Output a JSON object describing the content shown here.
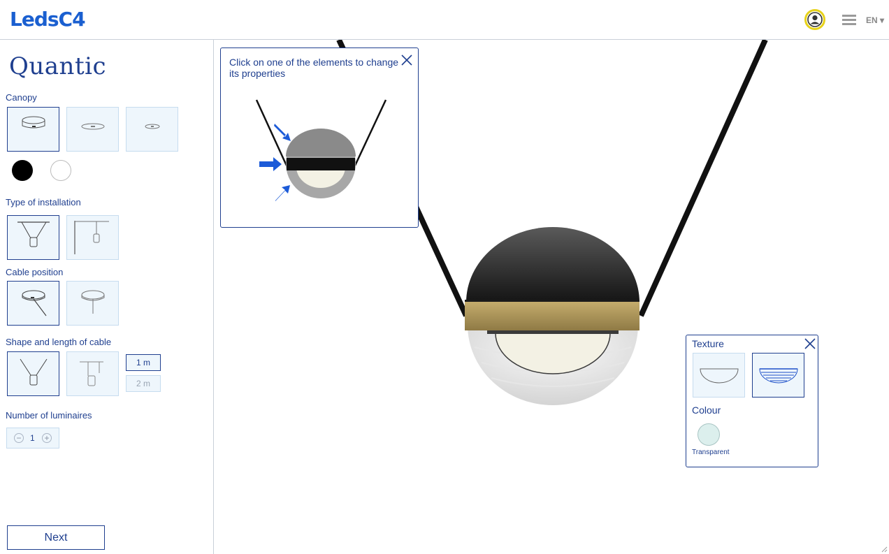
{
  "header": {
    "logo": "LedsC4",
    "language": "EN ▾",
    "icons": [
      "user-icon",
      "menu-icon"
    ]
  },
  "product": {
    "name": "Quantic"
  },
  "sections": {
    "canopy": "Canopy",
    "installation": "Type of installation",
    "cable_position": "Cable position",
    "cable_shape": "Shape and length of cable",
    "luminaires": "Number of luminaires"
  },
  "canopy_colors": [
    "#000000",
    "#ffffff"
  ],
  "cable_lengths": [
    "1 m",
    "2 m"
  ],
  "luminaires": {
    "value": "1",
    "minus": "−",
    "plus": "+"
  },
  "next_label": "Next",
  "hint_popup": {
    "text": "Click on one of the elements to change its properties"
  },
  "texture_popup": {
    "texture_label": "Texture",
    "colour_label": "Colour",
    "colour_name": "Transparent"
  },
  "colors": {
    "accent": "#1f3f8f",
    "brand": "#1a5fd0",
    "option_bg": "#eef6fc",
    "band_gold": "#b49a5a"
  }
}
